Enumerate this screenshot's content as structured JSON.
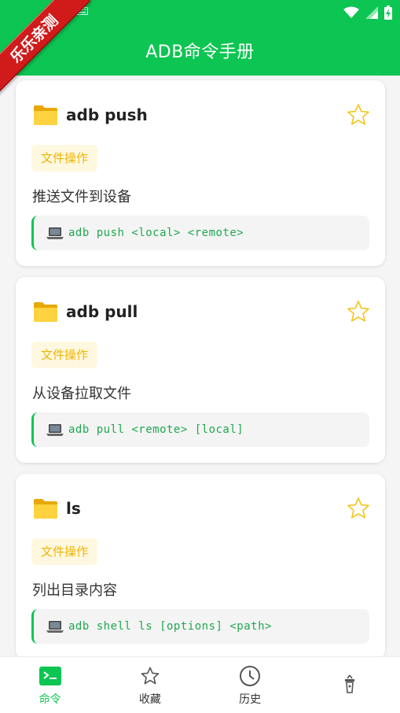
{
  "app": {
    "title": "ADB命令手册",
    "ribbon": "乐乐亲测"
  },
  "colors": {
    "primary": "#0dc552",
    "ribbon": "#d11a1a",
    "tag_text": "#f0b400",
    "tag_bg": "#fff8e1"
  },
  "commands": [
    {
      "name": "adb push",
      "category": "文件操作",
      "description": "推送文件到设备",
      "code": "adb push <local> <remote>",
      "icon": "folder-icon",
      "favorited": false
    },
    {
      "name": "adb pull",
      "category": "文件操作",
      "description": "从设备拉取文件",
      "code": "adb pull <remote> [local]",
      "icon": "folder-icon",
      "favorited": false
    },
    {
      "name": "ls",
      "category": "文件操作",
      "description": "列出目录内容",
      "code": "adb shell ls [options] <path>",
      "icon": "folder-icon",
      "favorited": false
    }
  ],
  "bottom_nav": [
    {
      "label": "命令",
      "icon": "terminal-icon",
      "active": true
    },
    {
      "label": "收藏",
      "icon": "star-icon",
      "active": false
    },
    {
      "label": "历史",
      "icon": "clock-icon",
      "active": false
    },
    {
      "label": "",
      "icon": "gift-icon",
      "active": false
    }
  ]
}
